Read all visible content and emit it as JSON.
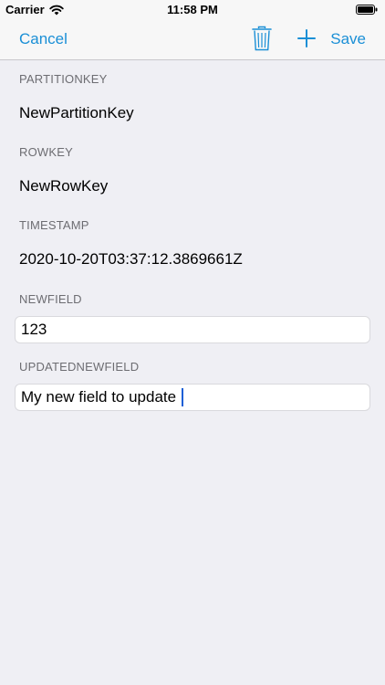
{
  "status_bar": {
    "carrier": "Carrier",
    "time": "11:58 PM"
  },
  "nav": {
    "cancel_label": "Cancel",
    "save_label": "Save",
    "accent_color": "#1a8fd6",
    "icons": [
      "trash-icon",
      "plus-icon"
    ]
  },
  "fields": {
    "partitionkey": {
      "label": "PARTITIONKEY",
      "value": "NewPartitionKey"
    },
    "rowkey": {
      "label": "ROWKEY",
      "value": "NewRowKey"
    },
    "timestamp": {
      "label": "TIMESTAMP",
      "value": "2020-10-20T03:37:12.3869661Z"
    },
    "newfield": {
      "label": "NEWFIELD",
      "value": "123"
    },
    "updatednewfield": {
      "label": "UPDATEDNEWFIELD",
      "value": "My new field to update"
    }
  }
}
